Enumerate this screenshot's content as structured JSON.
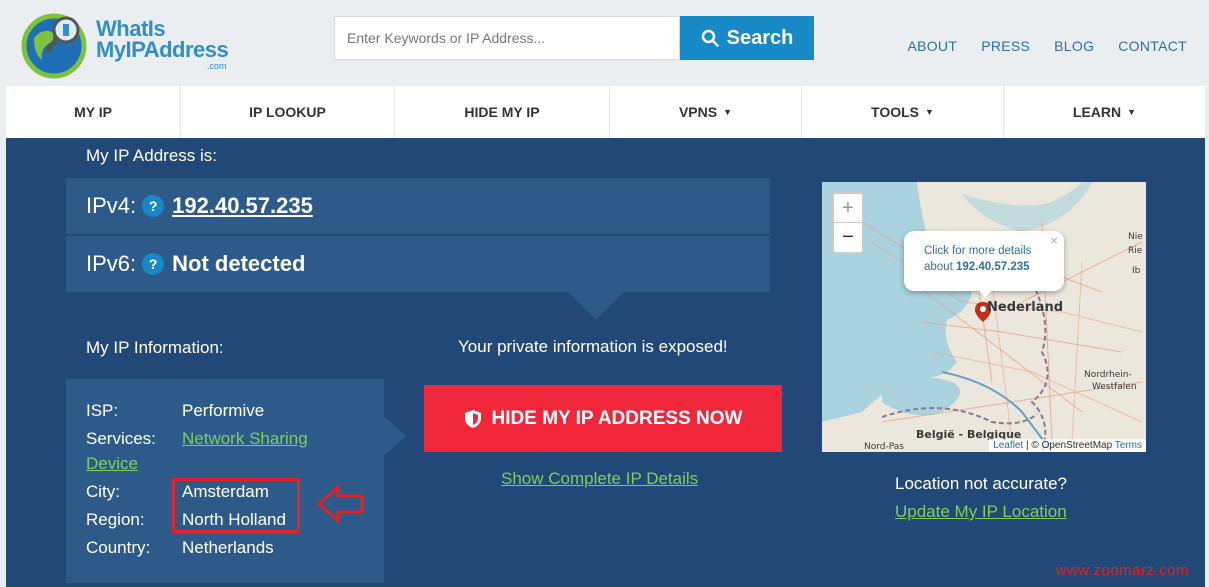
{
  "logo": {
    "line1": "WhatIs",
    "line2": "MyIPAddress",
    "suffix": ".com"
  },
  "search": {
    "placeholder": "Enter Keywords or IP Address...",
    "button_label": "Search"
  },
  "top_links": [
    "ABOUT",
    "PRESS",
    "BLOG",
    "CONTACT"
  ],
  "nav": [
    {
      "label": "MY IP",
      "dropdown": false
    },
    {
      "label": "IP LOOKUP",
      "dropdown": false
    },
    {
      "label": "HIDE MY IP",
      "dropdown": false
    },
    {
      "label": "VPNS",
      "dropdown": true
    },
    {
      "label": "TOOLS",
      "dropdown": true
    },
    {
      "label": "LEARN",
      "dropdown": true
    }
  ],
  "my_ip": {
    "heading": "My IP Address is:",
    "ipv4_label": "IPv4:",
    "ipv4_value": "192.40.57.235",
    "ipv6_label": "IPv6:",
    "ipv6_value": "Not detected",
    "help_glyph": "?"
  },
  "info": {
    "heading": "My IP Information:",
    "isp_key": "ISP:",
    "isp_val": "Performive",
    "services_key": "Services:",
    "services_val_1": "Network Sharing",
    "services_val_2": "Device",
    "city_key": "City:",
    "city_val": "Amsterdam",
    "region_key": "Region:",
    "region_val": "North Holland",
    "country_key": "Country:",
    "country_val": "Netherlands"
  },
  "privacy": {
    "message": "Your private information is exposed!",
    "hide_button": "HIDE MY IP ADDRESS NOW",
    "details_link": "Show Complete IP Details"
  },
  "map": {
    "zoom_in": "+",
    "zoom_out": "−",
    "popup_line1": "Click for more details",
    "popup_line2_prefix": "about",
    "popup_ip": "192.40.57.235",
    "popup_close": "×",
    "label_nederland": "Nederland",
    "label_belgie": "België - Belgique",
    "label_nrw_1": "Nordrhein-",
    "label_nrw_2": "Westfalen",
    "label_nord_pas": "Nord-Pas",
    "label_right_1": "Nie",
    "label_right_2": "Rie",
    "label_right_3": "Ib",
    "attribution_leaflet": "Leaflet",
    "attribution_sep": " | © OpenStreetMap ",
    "attribution_terms": "Terms"
  },
  "location": {
    "question": "Location not accurate?",
    "update_link": "Update My IP Location"
  },
  "watermark": "www.zoomarz.com",
  "colors": {
    "header_bg": "#ebeef1",
    "main_bg": "#214876",
    "panel_bg": "#2e5a8a",
    "accent_blue": "#1789c6",
    "link_green": "#7dcf5a",
    "cta_red": "#f0273a",
    "annotation_red": "#e32127"
  },
  "icons": {
    "search": "search-icon",
    "shield": "shield-icon",
    "map_marker": "map-marker-icon",
    "annotation_arrow": "arrow-left-icon"
  }
}
